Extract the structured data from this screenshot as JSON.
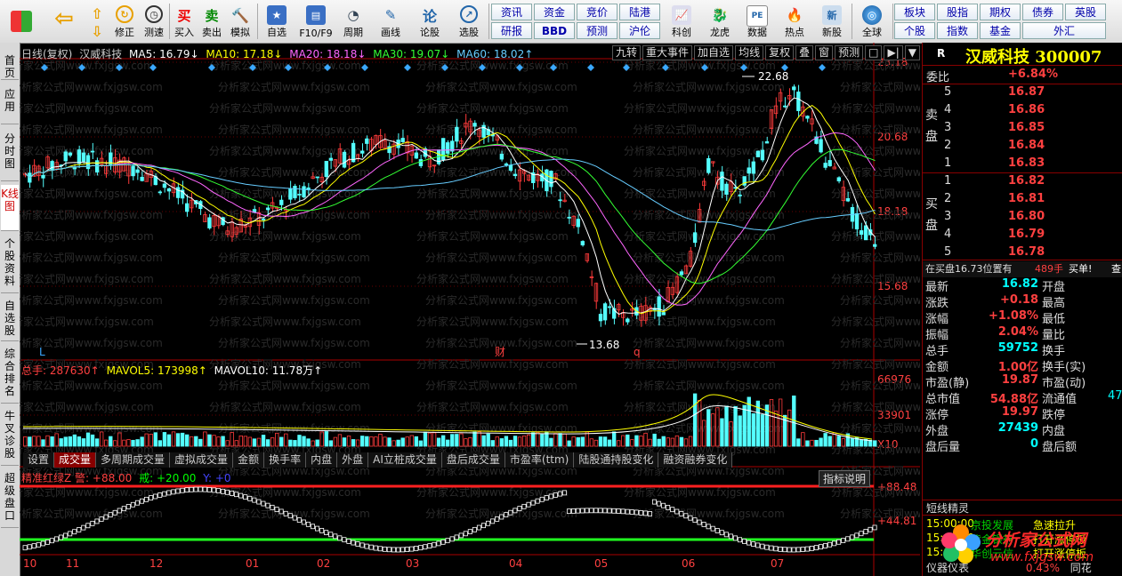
{
  "toolbar": {
    "buttons": [
      {
        "icon": "windows-icon",
        "label": ""
      },
      {
        "icon": "back-arrow-icon",
        "label": ""
      },
      {
        "icon": "up-arrow-icon",
        "label": ""
      },
      {
        "icon": "up-down-arrow-icon",
        "label": "修正"
      },
      {
        "icon": "speed-icon",
        "label": "测速"
      },
      {
        "icon": "clock-icon",
        "label": ""
      },
      {
        "icon": "buy-icon",
        "label": "买入",
        "glyph": "买"
      },
      {
        "icon": "sell-icon",
        "label": "卖出",
        "glyph": "卖"
      },
      {
        "icon": "hammer-icon",
        "label": "模拟"
      },
      {
        "icon": "self-select-icon",
        "label": "自选"
      },
      {
        "icon": "f10-icon",
        "label": "F10/F9"
      },
      {
        "icon": "period-icon",
        "label": "周期"
      },
      {
        "icon": "draw-line-icon",
        "label": "画线"
      },
      {
        "icon": "forum-icon",
        "label": "论股",
        "glyph": "论"
      },
      {
        "icon": "stock-select-icon",
        "label": "选股"
      }
    ],
    "grid": [
      [
        "资讯",
        "资金",
        "竞价",
        "陆港"
      ],
      [
        "研报",
        "BBD",
        "预测",
        "沪伦"
      ]
    ],
    "more_buttons": [
      "科创",
      "龙虎",
      "数据",
      "热点",
      "新股"
    ],
    "globe_label": "全球",
    "right_grid": [
      [
        "板块",
        "股指",
        "期权",
        "债券",
        "英股"
      ],
      [
        "个股",
        "指数",
        "基金",
        "外汇"
      ]
    ]
  },
  "left_tabs": [
    {
      "label": "首页",
      "active": false
    },
    {
      "label": "应用",
      "active": false
    },
    {
      "label": "分时图",
      "active": false
    },
    {
      "label": "K线图",
      "active": true
    },
    {
      "label": "个股资料",
      "active": false
    },
    {
      "label": "自选股",
      "active": false
    },
    {
      "label": "综合排名",
      "active": false
    },
    {
      "label": "牛叉诊股",
      "active": false
    },
    {
      "label": "超级盘口",
      "active": false
    }
  ],
  "chart": {
    "header": {
      "period": "日线(复权)",
      "name": "汉威科技",
      "ma5": "MA5: 16.79↓",
      "ma10": "MA10: 17.18↓",
      "ma20": "MA20: 18.18↓",
      "ma30": "MA30: 19.07↓",
      "ma60": "MA60: 18.02↑"
    },
    "tags": [
      "九转",
      "重大事件",
      "加自选",
      "均线",
      "复权",
      "叠",
      "窗",
      "预测",
      "□",
      "▶|",
      "▼"
    ],
    "price_axis": [
      "23.18",
      "20.68",
      "18.18",
      "15.68"
    ],
    "high_label": "22.68",
    "low_label": "13.68",
    "markers": [
      "L",
      "财",
      "q"
    ],
    "volume_header": {
      "total": "总手: 287630↑",
      "mavol5": "MAVOL5: 173998↑",
      "mavol10": "MAVOL10: 11.78万↑"
    },
    "volume_axis": [
      "66976",
      "33901",
      "X10"
    ],
    "bottom_tabs": [
      "设置",
      "成交量",
      "多周期成交量",
      "虚拟成交量",
      "金额",
      "换手率",
      "内盘",
      "外盘",
      "AI立桩成交量",
      "盘后成交量",
      "市盈率(ttm)",
      "陆股通持股变化",
      "融资融券变化"
    ],
    "active_tab": "成交量",
    "indicator_header": {
      "name": "精准红绿Z 警: +88.00",
      "warn": "戒: +20.00",
      "y": "Y: +0"
    },
    "indicator_btn": "指标说明",
    "ind_axis": [
      "+88.48",
      "+44.81"
    ],
    "months": [
      "10",
      "11",
      "12",
      "01",
      "02",
      "03",
      "04",
      "05",
      "06",
      "07"
    ],
    "watermark": "分析家公式网www.fxjgsw.com"
  },
  "right_panel": {
    "flag": "R",
    "title": "汉威科技 300007",
    "weibi_label": "委比",
    "weibi": "+6.84%",
    "sell_label": "卖盘",
    "sells": [
      [
        "5",
        "16.87"
      ],
      [
        "4",
        "16.86"
      ],
      [
        "3",
        "16.85"
      ],
      [
        "2",
        "16.84"
      ],
      [
        "1",
        "16.83"
      ]
    ],
    "buy_label": "买盘",
    "buys": [
      [
        "1",
        "16.82"
      ],
      [
        "2",
        "16.81"
      ],
      [
        "3",
        "16.80"
      ],
      [
        "4",
        "16.79"
      ],
      [
        "5",
        "16.78"
      ]
    ],
    "notice": "在买盘16.73位置有",
    "notice_qty": "489手",
    "notice_tail": "买单!",
    "notice_end": "查",
    "stats": [
      [
        "最新",
        "16.82",
        "开盘",
        ""
      ],
      [
        "涨跌",
        "+0.18",
        "最高",
        ""
      ],
      [
        "涨幅",
        "+1.08%",
        "最低",
        ""
      ],
      [
        "振幅",
        "2.04%",
        "量比",
        ""
      ],
      [
        "总手",
        "59752",
        "换手",
        ""
      ],
      [
        "金额",
        "1.00亿",
        "换手(实)",
        ""
      ],
      [
        "市盈(静)",
        "19.87",
        "市盈(动)",
        ""
      ],
      [
        "总市值",
        "54.88亿",
        "流通值",
        "47"
      ],
      [
        "涨停",
        "19.97",
        "跌停",
        ""
      ],
      [
        "外盘",
        "27439",
        "内盘",
        ""
      ],
      [
        "盘后量",
        "0",
        "盘后额",
        ""
      ]
    ],
    "news_title": "短线精灵",
    "news": [
      [
        "15:00:00",
        "京投发展",
        "急速拉升"
      ],
      [
        "15:00:00",
        "紫金银行",
        "打开涨停板"
      ],
      [
        "15:00:00",
        "华创云信",
        "打开涨停板"
      ]
    ],
    "news_tail": "仪器仪表",
    "news_pct": "0.43%",
    "news_tail2": "同花",
    "logo_text": "分析家公式网",
    "logo_url": "www.fxjgsw.com",
    "colors": {
      "up": "#ff4040",
      "down": "#00d000",
      "accent": "#ffff00"
    }
  }
}
